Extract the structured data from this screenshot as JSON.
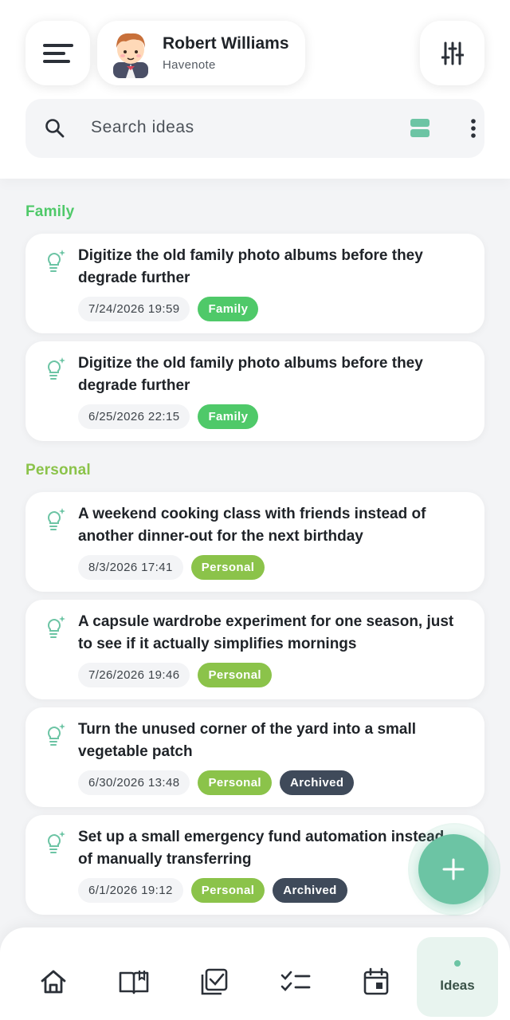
{
  "header": {
    "user_name": "Robert Williams",
    "app_name": "Havenote"
  },
  "search": {
    "placeholder": "Search ideas"
  },
  "colors": {
    "accent": "#6cc4a4",
    "family": "#4fc969",
    "personal": "#8bc34a",
    "archived": "#3f4a5a"
  },
  "sections": [
    {
      "label": "Family",
      "ideas": [
        {
          "title_line1": "Digitize the old family photo albums before they",
          "title_line2": "degrade further",
          "date": "7/24/2026 19:59",
          "tag": "Family"
        },
        {
          "title_line1": "Digitize the old family photo albums before they",
          "title_line2": "degrade further",
          "date": "6/25/2026 22:15",
          "tag": "Family"
        }
      ]
    },
    {
      "label": "Personal",
      "ideas": [
        {
          "title_line1": "A weekend cooking class with friends instead of",
          "title_line2": "another dinner-out for the next birthday",
          "date": "8/3/2026 17:41",
          "tag": "Personal"
        },
        {
          "title_line1": "A capsule wardrobe experiment for one season, just",
          "title_line2": "to see if it actually simplifies mornings",
          "date": "7/26/2026 19:46",
          "tag": "Personal"
        },
        {
          "title_line1": "Turn the unused corner of the yard into a small",
          "title_line2": "vegetable patch",
          "date": "6/30/2026 13:48",
          "tag": "Personal",
          "status": "Archived"
        },
        {
          "title_line1": "Set up a small emergency fund automation instead",
          "title_line2": "of manually transferring",
          "date": "6/1/2026 19:12",
          "tag": "Personal",
          "status": "Archived"
        }
      ]
    }
  ],
  "nav": {
    "items": [
      "home-icon",
      "book-icon",
      "checkbox-icon",
      "checklist-icon",
      "calendar-icon"
    ],
    "active_label": "Ideas"
  }
}
